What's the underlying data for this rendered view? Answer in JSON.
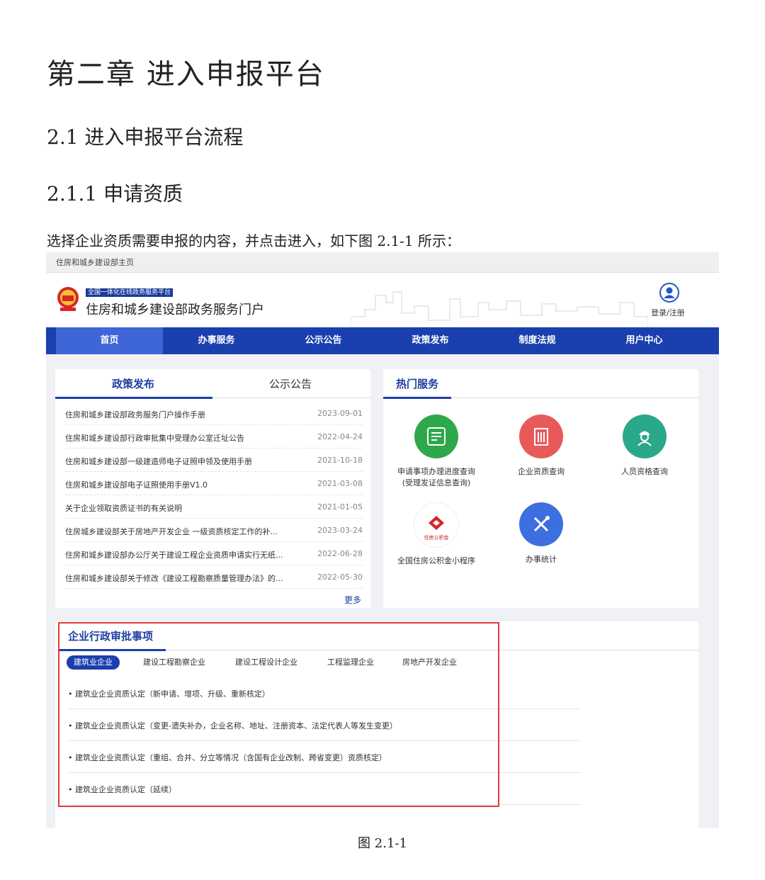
{
  "document": {
    "chapter_title": "第二章  进入申报平台",
    "section_title": "2.1 进入申报平台流程",
    "subsection_title": "2.1.1 申请资质",
    "instruction": "选择企业资质需要申报的内容，并点击进入，如下图 2.1-1 所示：",
    "figure_caption": "图 2.1-1"
  },
  "screenshot": {
    "top_link": "住房和城乡建设部主页",
    "portal_tag": "全国一体化在线政务服务平台",
    "portal_name": "住房和城乡建设部政务服务门户",
    "login_label": "登录/注册",
    "nav": [
      "首页",
      "办事服务",
      "公示公告",
      "政策发布",
      "制度法规",
      "用户中心"
    ],
    "news_panel": {
      "tabs": [
        "政策发布",
        "公示公告"
      ],
      "items": [
        {
          "title": "住房和城乡建设部政务服务门户操作手册",
          "date": "2023-09-01"
        },
        {
          "title": "住房和城乡建设部行政审批集中受理办公室迁址公告",
          "date": "2022-04-24"
        },
        {
          "title": "住房和城乡建设部一级建造师电子证照申领及使用手册",
          "date": "2021-10-18"
        },
        {
          "title": "住房和城乡建设部电子证照使用手册V1.0",
          "date": "2021-03-08"
        },
        {
          "title": "关于企业领取资质证书的有关说明",
          "date": "2021-01-05"
        },
        {
          "title": "住房城乡建设部关于房地产开发企业 一级资质核定工作的补...",
          "date": "2023-03-24"
        },
        {
          "title": "住房和城乡建设部办公厅关于建设工程企业资质申请实行无纸...",
          "date": "2022-06-28"
        },
        {
          "title": "住房和城乡建设部关于修改《建设工程勘察质量管理办法》的...",
          "date": "2022-05-30"
        }
      ],
      "more": "更多"
    },
    "hot_services": {
      "title": "热门服务",
      "items": [
        {
          "label_line1": "申请事项办理进度查询",
          "label_line2": "(受理发证信息查询)",
          "icon": "form-icon",
          "color": "#2ea84a"
        },
        {
          "label_line1": "企业资质查询",
          "label_line2": "",
          "icon": "building-icon",
          "color": "#e85a5a"
        },
        {
          "label_line1": "人员资格查询",
          "label_line2": "",
          "icon": "worker-icon",
          "color": "#2aa88a"
        },
        {
          "label_line1": "全国住房公积金小程序",
          "label_line2": "",
          "icon": "housing-fund-logo",
          "logo_text": "住房公积金",
          "color": "#ffffff"
        },
        {
          "label_line1": "办事统计",
          "label_line2": "",
          "icon": "tools-icon",
          "color": "#3e6fe0"
        }
      ]
    },
    "approval_section": {
      "title": "企业行政审批事项",
      "tabs": [
        "建筑业企业",
        "建设工程勘察企业",
        "建设工程设计企业",
        "工程监理企业",
        "房地产开发企业"
      ],
      "items": [
        "建筑业企业资质认定（新申请、增项、升级、重新核定）",
        "建筑业企业资质认定（变更-遗失补办，企业名称、地址、注册资本、法定代表人等发生变更）",
        "建筑业企业资质认定（重组、合并、分立等情况（含国有企业改制、跨省变更）资质核定）",
        "建筑业企业资质认定（延续）"
      ]
    }
  }
}
